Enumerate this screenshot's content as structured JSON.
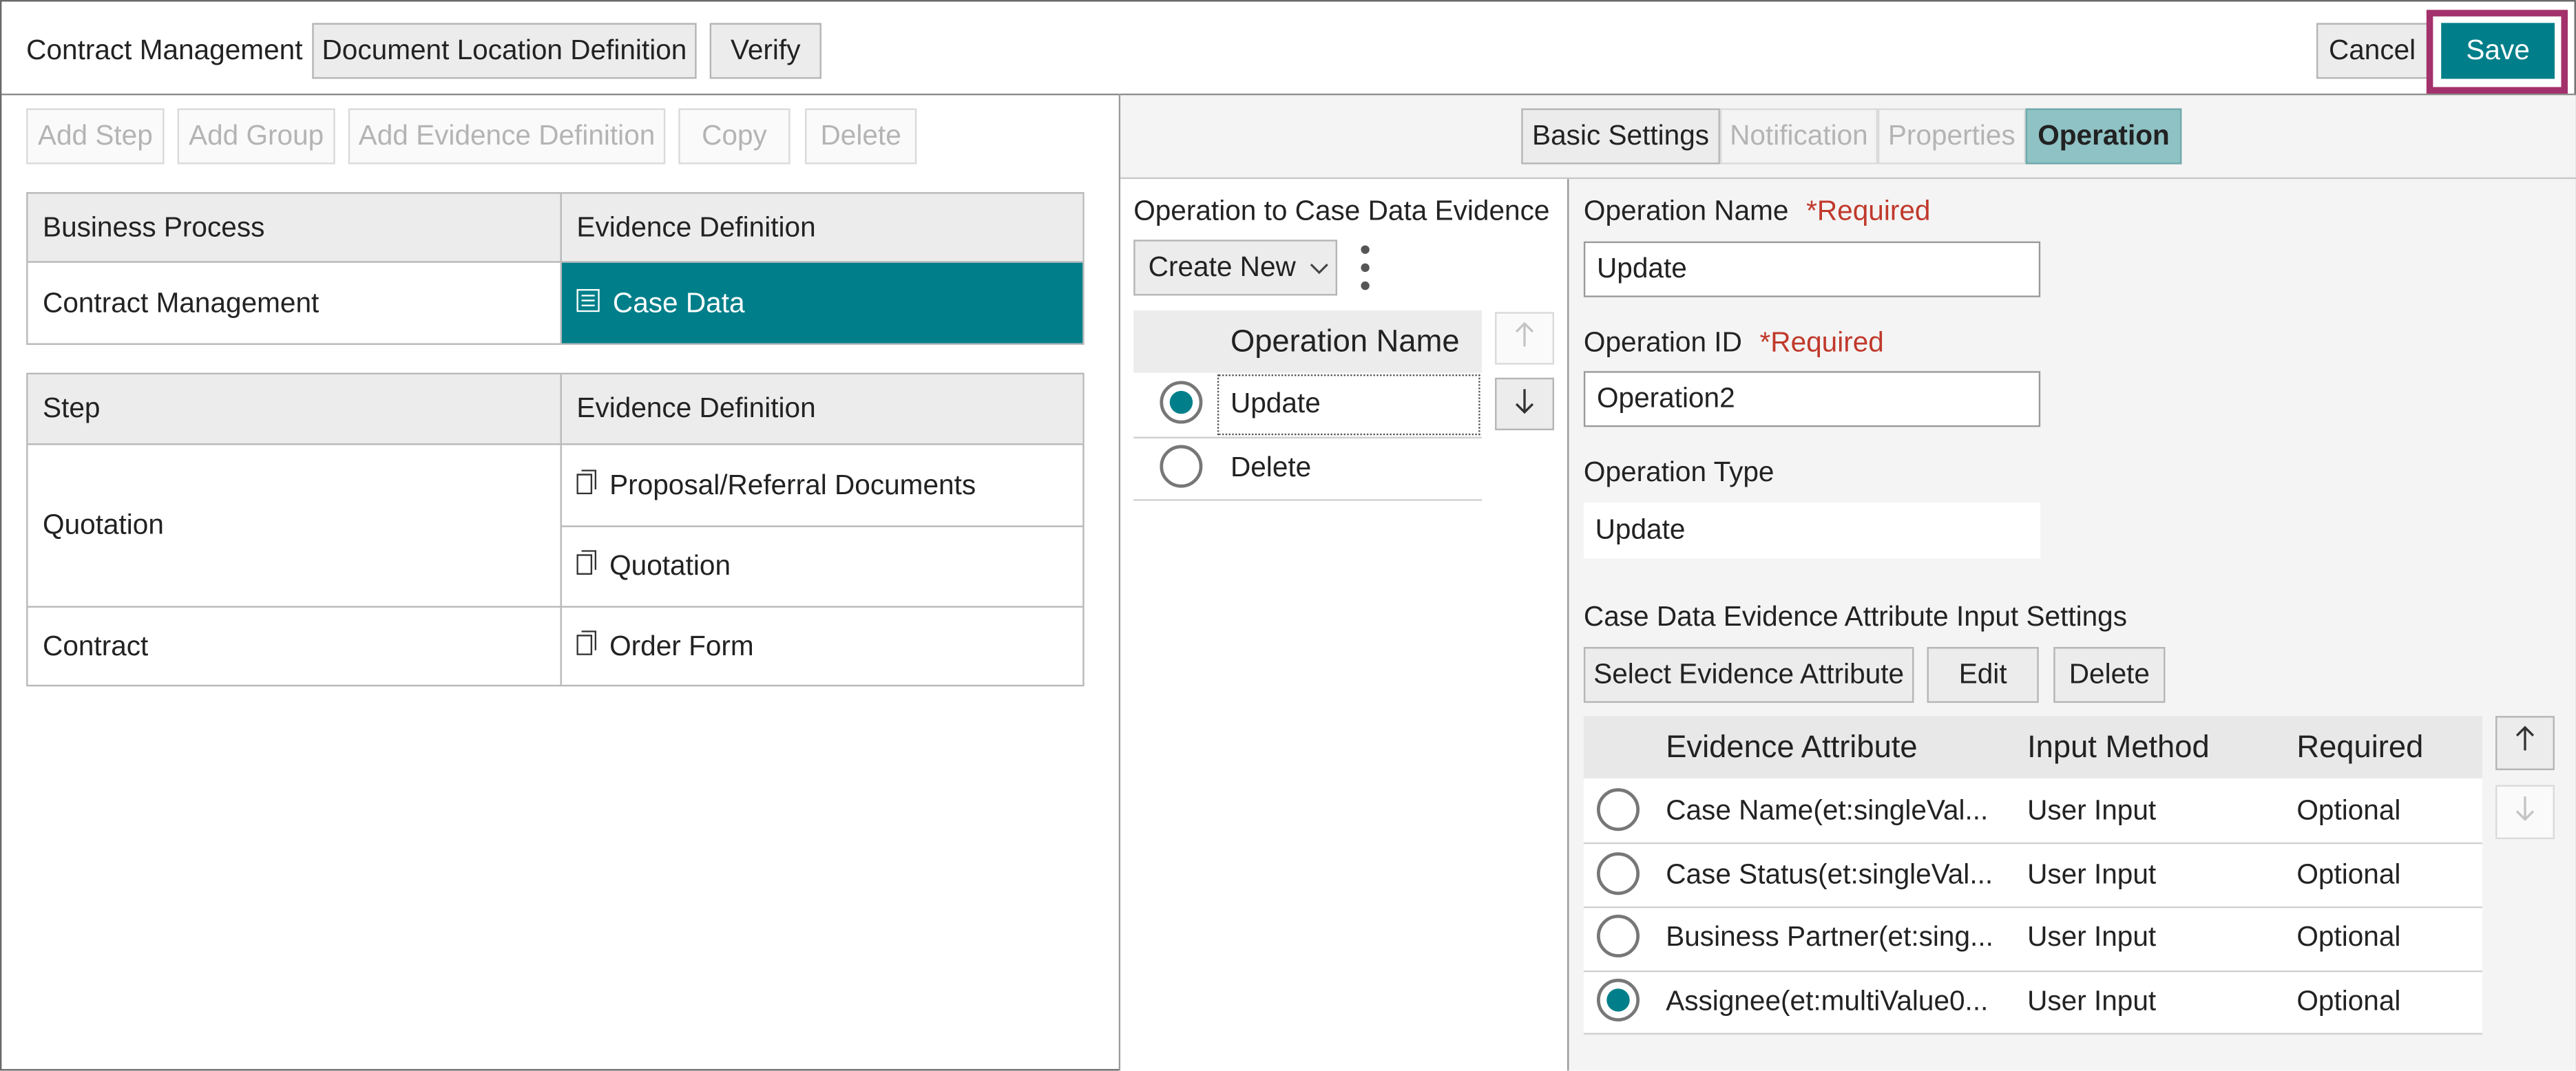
{
  "header": {
    "title": "Contract Management",
    "doc_location_label": "Document Location Definition",
    "verify_label": "Verify",
    "cancel_label": "Cancel",
    "save_label": "Save"
  },
  "left_toolbar": {
    "add_step": "Add Step",
    "add_group": "Add Group",
    "add_evidence": "Add Evidence Definition",
    "copy": "Copy",
    "delete": "Delete"
  },
  "process_table": {
    "col_process": "Business Process",
    "col_evidence": "Evidence Definition",
    "process_name": "Contract Management",
    "evidence_name": "Case Data"
  },
  "step_table": {
    "col_step": "Step",
    "col_evidence": "Evidence Definition",
    "rows": [
      {
        "step": "Quotation",
        "evidence": "Proposal/Referral Documents"
      },
      {
        "step": "",
        "evidence": "Quotation"
      },
      {
        "step": "Contract",
        "evidence": "Order Form"
      }
    ]
  },
  "tabs": {
    "basic": "Basic Settings",
    "notification": "Notification",
    "properties": "Properties",
    "operation": "Operation"
  },
  "ops_panel": {
    "title": "Operation to Case Data Evidence",
    "create_new": "Create New",
    "col_name": "Operation Name",
    "items": [
      "Update",
      "Delete"
    ],
    "selected_index": 0
  },
  "detail": {
    "op_name_label": "Operation Name",
    "required_text": "*Required",
    "op_name_value": "Update",
    "op_id_label": "Operation ID",
    "op_id_value": "Operation2",
    "op_type_label": "Operation Type",
    "op_type_value": "Update",
    "attr_section_title": "Case Data Evidence Attribute Input Settings",
    "select_attr_button": "Select Evidence Attribute",
    "edit_button": "Edit",
    "delete_button": "Delete",
    "attr_cols": {
      "attribute": "Evidence Attribute",
      "method": "Input Method",
      "required": "Required"
    },
    "attr_rows": [
      {
        "attribute": "Case Name(et:singleVal...",
        "method": "User Input",
        "required": "Optional",
        "selected": false
      },
      {
        "attribute": "Case Status(et:singleVal...",
        "method": "User Input",
        "required": "Optional",
        "selected": false
      },
      {
        "attribute": "Business Partner(et:sing...",
        "method": "User Input",
        "required": "Optional",
        "selected": false
      },
      {
        "attribute": "Assignee(et:multiValue0...",
        "method": "User Input",
        "required": "Optional",
        "selected": true
      }
    ]
  },
  "colors": {
    "accent": "#007f8a",
    "required": "#c0392b",
    "highlight_border": "#a3316b"
  },
  "icons": {
    "list": "list-icon",
    "document": "document-icon",
    "arrow_up": "arrow-up-icon",
    "arrow_down": "arrow-down-icon",
    "chevron": "chevron-down-icon",
    "kebab": "kebab-menu-icon"
  }
}
